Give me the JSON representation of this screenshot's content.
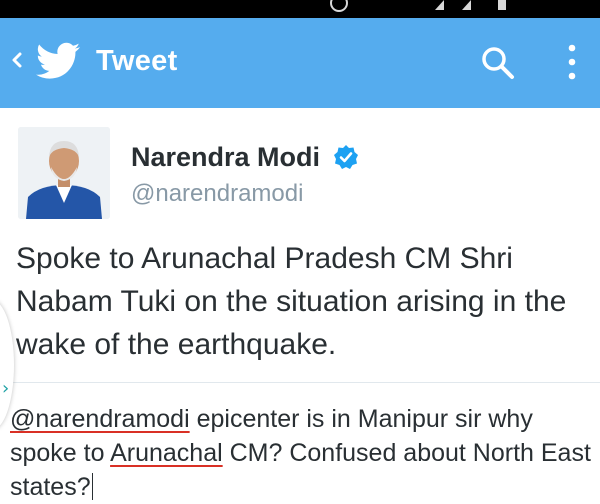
{
  "app_bar": {
    "title": "Tweet",
    "color": "#55acee",
    "back_icon": "chevron-left-icon",
    "logo_icon": "twitter-bird-icon",
    "search_icon": "search-icon",
    "overflow_icon": "more-vertical-icon"
  },
  "tweet": {
    "author_name": "Narendra Modi",
    "author_handle": "@narendramodi",
    "verified": true,
    "verified_icon": "verified-badge-icon",
    "avatar_icon": "avatar",
    "text": "Spoke to Arunachal Pradesh CM Shri Nabam Tuki on the situation arising in the wake of the earthquake."
  },
  "reply_compose": {
    "mention": "@narendramodi",
    "text_part1": " epicenter is in Manipur sir why spoke to ",
    "highlighted_word": "Arunachal",
    "text_part2": " CM? Confused about North East states?",
    "spellcheck_color": "#d93025"
  },
  "side_handle_icon": "chevron-right-icon"
}
